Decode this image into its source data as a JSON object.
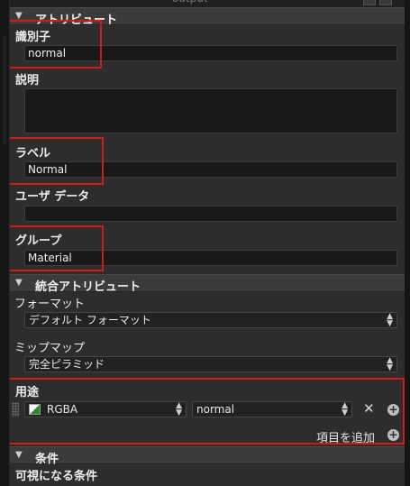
{
  "panel_title": "output",
  "attributes": {
    "header": "アトリビュート",
    "identifier": {
      "label": "識別子",
      "value": "normal"
    },
    "description": {
      "label": "説明",
      "value": ""
    },
    "display_label": {
      "label": "ラベル",
      "value": "Normal"
    },
    "user_data": {
      "label": "ユーザ データ",
      "value": ""
    },
    "group": {
      "label": "グループ",
      "value": "Material"
    }
  },
  "combined": {
    "header": "統合アトリビュート",
    "format": {
      "label": "フォーマット",
      "value": "デフォルト フォーマット"
    },
    "mipmap": {
      "label": "ミップマップ",
      "value": "完全ピラミッド"
    },
    "usage": {
      "label": "用途",
      "channel": "RGBA",
      "semantic": "normal",
      "add_label": "項目を追加"
    }
  },
  "conditions": {
    "header": "条件",
    "visible_label": "可視になる条件"
  },
  "colors": {
    "highlight": "#d11a1a",
    "panel_bg": "#2d2d2d",
    "field_bg": "#191919"
  }
}
